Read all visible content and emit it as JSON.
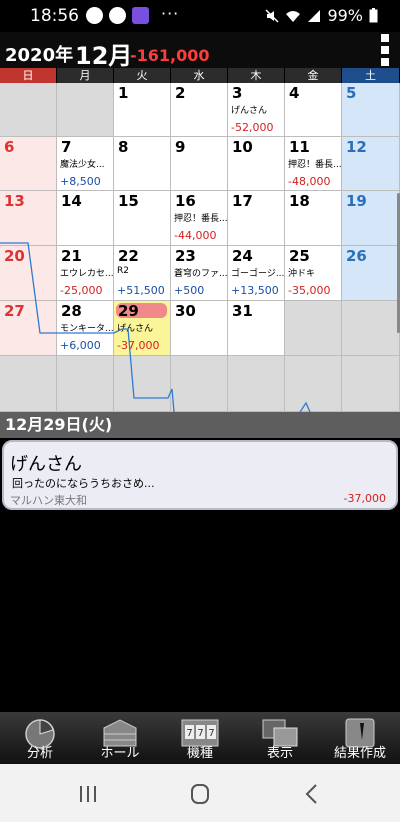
{
  "status_bar": {
    "time": "18:56",
    "dots": "···",
    "battery": "99%"
  },
  "header": {
    "year": "2020年",
    "month": "12月",
    "monthly_total": "-161,000"
  },
  "weekdays": [
    "日",
    "月",
    "火",
    "水",
    "木",
    "金",
    "土"
  ],
  "calendar": {
    "cells": [
      {
        "day": "",
        "memo": "",
        "amount": ""
      },
      {
        "day": "",
        "memo": "",
        "amount": ""
      },
      {
        "day": "1",
        "memo": "",
        "amount": ""
      },
      {
        "day": "2",
        "memo": "",
        "amount": ""
      },
      {
        "day": "3",
        "memo": "げんさん",
        "amount": "-52,000"
      },
      {
        "day": "4",
        "memo": "",
        "amount": ""
      },
      {
        "day": "5",
        "memo": "",
        "amount": ""
      },
      {
        "day": "6",
        "memo": "",
        "amount": ""
      },
      {
        "day": "7",
        "memo": "魔法少女...",
        "amount": "+8,500"
      },
      {
        "day": "8",
        "memo": "",
        "amount": ""
      },
      {
        "day": "9",
        "memo": "",
        "amount": ""
      },
      {
        "day": "10",
        "memo": "",
        "amount": ""
      },
      {
        "day": "11",
        "memo": "押忍！番長...",
        "amount": "-48,000"
      },
      {
        "day": "12",
        "memo": "",
        "amount": ""
      },
      {
        "day": "13",
        "memo": "",
        "amount": ""
      },
      {
        "day": "14",
        "memo": "",
        "amount": ""
      },
      {
        "day": "15",
        "memo": "",
        "amount": ""
      },
      {
        "day": "16",
        "memo": "押忍！番長...",
        "amount": "-44,000"
      },
      {
        "day": "17",
        "memo": "",
        "amount": ""
      },
      {
        "day": "18",
        "memo": "",
        "amount": ""
      },
      {
        "day": "19",
        "memo": "",
        "amount": ""
      },
      {
        "day": "20",
        "memo": "",
        "amount": ""
      },
      {
        "day": "21",
        "memo": "エウレカセ...",
        "amount": "-25,000"
      },
      {
        "day": "22",
        "memo": "R2",
        "amount": "+51,500"
      },
      {
        "day": "23",
        "memo": "蒼穹のファ...",
        "amount": "+500"
      },
      {
        "day": "24",
        "memo": "ゴーゴージ...",
        "amount": "+13,500"
      },
      {
        "day": "25",
        "memo": "沖ドキ",
        "amount": "-35,000"
      },
      {
        "day": "26",
        "memo": "",
        "amount": ""
      },
      {
        "day": "27",
        "memo": "",
        "amount": ""
      },
      {
        "day": "28",
        "memo": "モンキータ...",
        "amount": "+6,000"
      },
      {
        "day": "29",
        "memo": "げんさん",
        "amount": "-37,000"
      },
      {
        "day": "30",
        "memo": "",
        "amount": ""
      },
      {
        "day": "31",
        "memo": "",
        "amount": ""
      },
      {
        "day": "",
        "memo": "",
        "amount": ""
      },
      {
        "day": "",
        "memo": "",
        "amount": ""
      },
      {
        "day": "",
        "memo": "",
        "amount": ""
      },
      {
        "day": "",
        "memo": "",
        "amount": ""
      },
      {
        "day": "",
        "memo": "",
        "amount": ""
      },
      {
        "day": "",
        "memo": "",
        "amount": ""
      },
      {
        "day": "",
        "memo": "",
        "amount": ""
      },
      {
        "day": "",
        "memo": "",
        "amount": ""
      },
      {
        "day": "",
        "memo": "",
        "amount": ""
      }
    ],
    "selected_day": "29"
  },
  "selected_date": "12月29日(火)",
  "entry": {
    "title": "げんさん",
    "memo": "回ったのにならうちおさめ...",
    "store": "マルハン東大和",
    "amount": "-37,000"
  },
  "toolbar": {
    "analysis": "分析",
    "hall": "ホール",
    "machine": "機種",
    "display": "表示",
    "result": "結果作成"
  },
  "colors": {
    "sunday_header": "#c0352d",
    "saturday_header": "#1e4d8c",
    "negative": "#d32222",
    "positive": "#1c4fa8",
    "selected": "#fbf59a"
  }
}
